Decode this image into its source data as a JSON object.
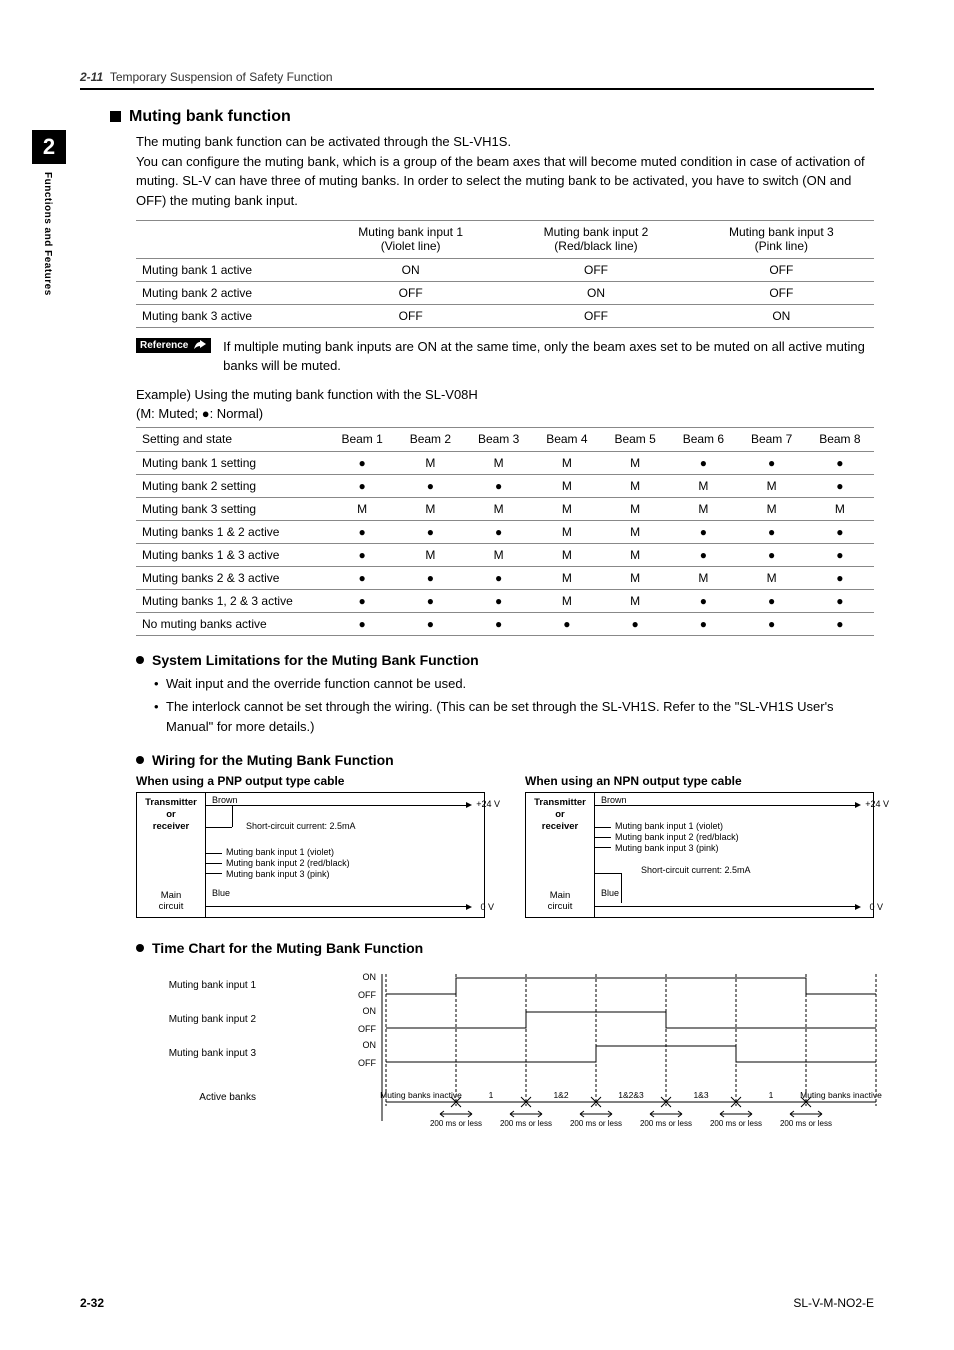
{
  "header": {
    "section_num": "2-11",
    "section_title": "Temporary Suspension of Safety Function"
  },
  "sidetab": {
    "chapter": "2",
    "label": "Functions and Features"
  },
  "h1": "Muting bank function",
  "intro": "The muting bank function can be activated through the SL-VH1S.\nYou can configure the muting bank, which is a group of the beam axes that will become muted condition in case of activation of muting. SL-V can have three of muting banks. In order to select the muting bank to be activated, you have to switch (ON and OFF) the muting bank input.",
  "table1": {
    "cols": [
      "",
      "Muting bank input 1\n(Violet line)",
      "Muting bank input 2\n(Red/black line)",
      "Muting bank input 3\n(Pink line)"
    ],
    "rows": [
      [
        "Muting bank 1 active",
        "ON",
        "OFF",
        "OFF"
      ],
      [
        "Muting bank 2 active",
        "OFF",
        "ON",
        "OFF"
      ],
      [
        "Muting bank 3 active",
        "OFF",
        "OFF",
        "ON"
      ]
    ]
  },
  "reference": {
    "badge": "Reference",
    "text": "If multiple muting bank inputs are ON at the same time, only the beam axes set to be muted on all active muting banks will be muted."
  },
  "example": {
    "title": "Example) Using the muting bank function with the SL-V08H",
    "legend": "(M: Muted; ●: Normal)",
    "cols": [
      "Setting and state",
      "Beam 1",
      "Beam 2",
      "Beam 3",
      "Beam 4",
      "Beam 5",
      "Beam 6",
      "Beam 7",
      "Beam 8"
    ],
    "rows": [
      [
        "Muting bank 1 setting",
        "●",
        "M",
        "M",
        "M",
        "M",
        "●",
        "●",
        "●"
      ],
      [
        "Muting bank 2 setting",
        "●",
        "●",
        "●",
        "M",
        "M",
        "M",
        "M",
        "●"
      ],
      [
        "Muting bank 3 setting",
        "M",
        "M",
        "M",
        "M",
        "M",
        "M",
        "M",
        "M"
      ],
      [
        "Muting banks 1 & 2 active",
        "●",
        "●",
        "●",
        "M",
        "M",
        "●",
        "●",
        "●"
      ],
      [
        "Muting banks 1 & 3 active",
        "●",
        "M",
        "M",
        "M",
        "M",
        "●",
        "●",
        "●"
      ],
      [
        "Muting banks 2 & 3 active",
        "●",
        "●",
        "●",
        "M",
        "M",
        "M",
        "M",
        "●"
      ],
      [
        "Muting banks 1, 2 & 3 active",
        "●",
        "●",
        "●",
        "M",
        "M",
        "●",
        "●",
        "●"
      ],
      [
        "No muting banks active",
        "●",
        "●",
        "●",
        "●",
        "●",
        "●",
        "●",
        "●"
      ]
    ]
  },
  "limits": {
    "heading": "System Limitations for the Muting Bank Function",
    "items": [
      "Wait input and the override function cannot be used.",
      "The interlock cannot be set through the wiring. (This can be set through the SL-VH1S. Refer to the \"SL-VH1S User's Manual\" for more details.)"
    ]
  },
  "wiring": {
    "heading": "Wiring for the Muting Bank Function",
    "pnp_title": "When using a PNP output type cable",
    "npn_title": "When using an NPN output type cable",
    "block_tx": "Transmitter\nor\nreceiver",
    "block_main": "Main\ncircuit",
    "brown": "Brown",
    "blue": "Blue",
    "v24": "+24 V",
    "v0": "0 V",
    "short": "Short-circuit current: 2.5mA",
    "in1": "Muting bank input 1 (violet)",
    "in2": "Muting bank input 2 (red/black)",
    "in3": "Muting bank input 3 (pink)"
  },
  "timechart": {
    "heading": "Time Chart for the Muting Bank Function",
    "rows": [
      "Muting bank input 1",
      "Muting bank input 2",
      "Muting bank input 3",
      "Active banks"
    ],
    "on": "ON",
    "off": "OFF",
    "states": [
      "Muting banks inactive",
      "1",
      "1&2",
      "1&2&3",
      "1&3",
      "1",
      "Muting banks inactive"
    ],
    "tick": "200 ms or less"
  },
  "chart_data": {
    "type": "table",
    "title": "Time Chart for the Muting Bank Function",
    "signals": [
      {
        "name": "Muting bank input 1",
        "sequence": [
          "OFF",
          "ON",
          "ON",
          "ON",
          "ON",
          "ON",
          "OFF"
        ]
      },
      {
        "name": "Muting bank input 2",
        "sequence": [
          "OFF",
          "OFF",
          "ON",
          "ON",
          "OFF",
          "OFF",
          "OFF"
        ]
      },
      {
        "name": "Muting bank input 3",
        "sequence": [
          "OFF",
          "OFF",
          "OFF",
          "ON",
          "ON",
          "OFF",
          "OFF"
        ]
      }
    ],
    "active_banks": [
      "Muting banks inactive",
      "1",
      "1&2",
      "1&2&3",
      "1&3",
      "1",
      "Muting banks inactive"
    ],
    "transition_max": "200 ms or less"
  },
  "footer": {
    "page": "2-32",
    "doc": "SL-V-M-NO2-E"
  }
}
